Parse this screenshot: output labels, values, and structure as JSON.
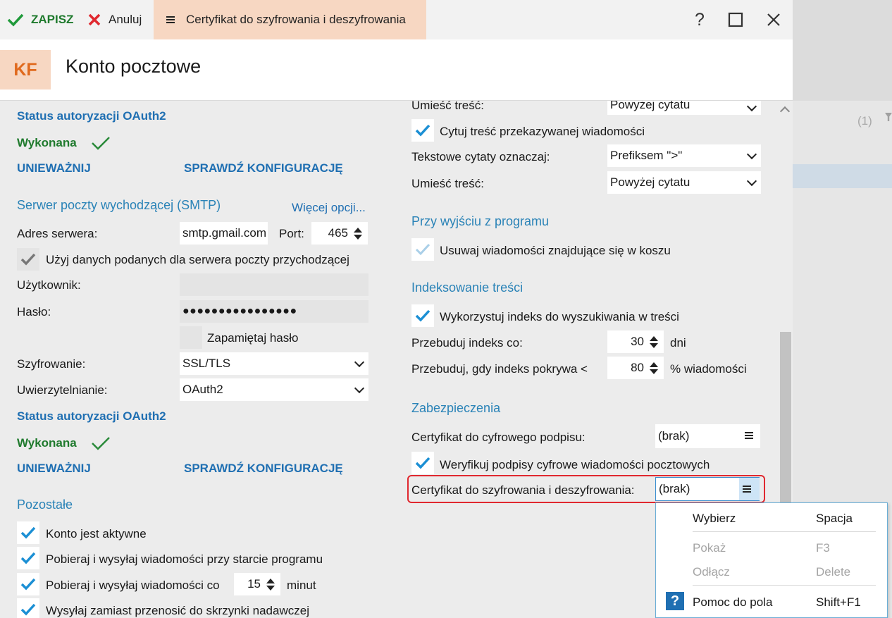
{
  "toolbar": {
    "save_label": "ZAPISZ",
    "cancel_label": "Anuluj",
    "active_tab_label": "Certyfikat do szyfrowania i deszyfrowania",
    "help_glyph": "?"
  },
  "header": {
    "logo": "KF",
    "title": "Konto pocztowe"
  },
  "left": {
    "oauth_top": {
      "heading": "Status autoryzacji OAuth2",
      "status": "Wykonana",
      "revoke": "UNIEWAŻNIJ",
      "check": "SPRAWDŹ KONFIGURACJĘ"
    },
    "smtp": {
      "heading": "Serwer poczty wychodzącej (SMTP)",
      "more_options": "Więcej opcji...",
      "server_label": "Adres serwera:",
      "server_value": "smtp.gmail.com",
      "port_label": "Port:",
      "port_value": "465",
      "use_incoming_label": "Użyj danych podanych dla serwera poczty przychodzącej",
      "user_label": "Użytkownik:",
      "user_value": "",
      "password_label": "Hasło:",
      "password_value": "●●●●●●●●●●●●●●●●",
      "remember_label": "Zapamiętaj hasło",
      "encryption_label": "Szyfrowanie:",
      "encryption_value": "SSL/TLS",
      "auth_label": "Uwierzytelnianie:",
      "auth_value": "OAuth2"
    },
    "oauth_bottom": {
      "heading": "Status autoryzacji OAuth2",
      "status": "Wykonana",
      "revoke": "UNIEWAŻNIJ",
      "check": "SPRAWDŹ KONFIGURACJĘ"
    },
    "other": {
      "heading": "Pozostałe",
      "active_label": "Konto jest aktywne",
      "fetch_start_label": "Pobieraj i wysyłaj wiadomości przy starcie programu",
      "fetch_every_label": "Pobieraj i wysyłaj wiadomości co",
      "fetch_every_value": "15",
      "fetch_every_unit": "minut",
      "send_instead_label": "Wysyłaj zamiast przenosić do skrzynki nadawczej"
    }
  },
  "right": {
    "place_content_label_1": "Umieść treść:",
    "place_content_value_1": "Powyżej cytatu",
    "quote_forwarded_label": "Cytuj treść przekazywanej wiadomości",
    "text_quotes_label": "Tekstowe cytaty oznaczaj:",
    "text_quotes_value": "Prefiksem \">\"",
    "place_content_label_2": "Umieść treść:",
    "place_content_value_2": "Powyżej cytatu",
    "exit_heading": "Przy wyjściu z programu",
    "delete_trash_label": "Usuwaj wiadomości znajdujące się w koszu",
    "index_heading": "Indeksowanie treści",
    "use_index_label": "Wykorzystuj indeks do wyszukiwania w treści",
    "rebuild_every_label": "Przebuduj indeks co:",
    "rebuild_every_value": "30",
    "rebuild_every_unit": "dni",
    "rebuild_cover_label": "Przebuduj, gdy indeks pokrywa <",
    "rebuild_cover_value": "80",
    "rebuild_cover_unit": "% wiadomości",
    "security_heading": "Zabezpieczenia",
    "sign_cert_label": "Certyfikat do cyfrowego podpisu:",
    "sign_cert_value": "(brak)",
    "verify_sig_label": "Weryfikuj podpisy cyfrowe wiadomości pocztowych",
    "enc_cert_label": "Certyfikat do szyfrowania i deszyfrowania:",
    "enc_cert_value": "(brak)"
  },
  "context_menu": {
    "items": [
      {
        "label": "Wybierz",
        "shortcut": "Spacja",
        "enabled": true
      },
      {
        "label": "Pokaż",
        "shortcut": "F3",
        "enabled": false
      },
      {
        "label": "Odłącz",
        "shortcut": "Delete",
        "enabled": false
      },
      {
        "label": "Pomoc do pola",
        "shortcut": "Shift+F1",
        "enabled": true,
        "icon": "help-icon"
      }
    ]
  },
  "background_app": {
    "count": "(1)"
  },
  "colors": {
    "accent": "#2a83b7",
    "ok_green": "#1f7a2d",
    "link_blue": "#1f6fb2",
    "check_blue": "#1b8fd4",
    "highlight_red": "#e0282f",
    "logo_bg": "#f7d7c2",
    "logo_text": "#e06a1e"
  }
}
